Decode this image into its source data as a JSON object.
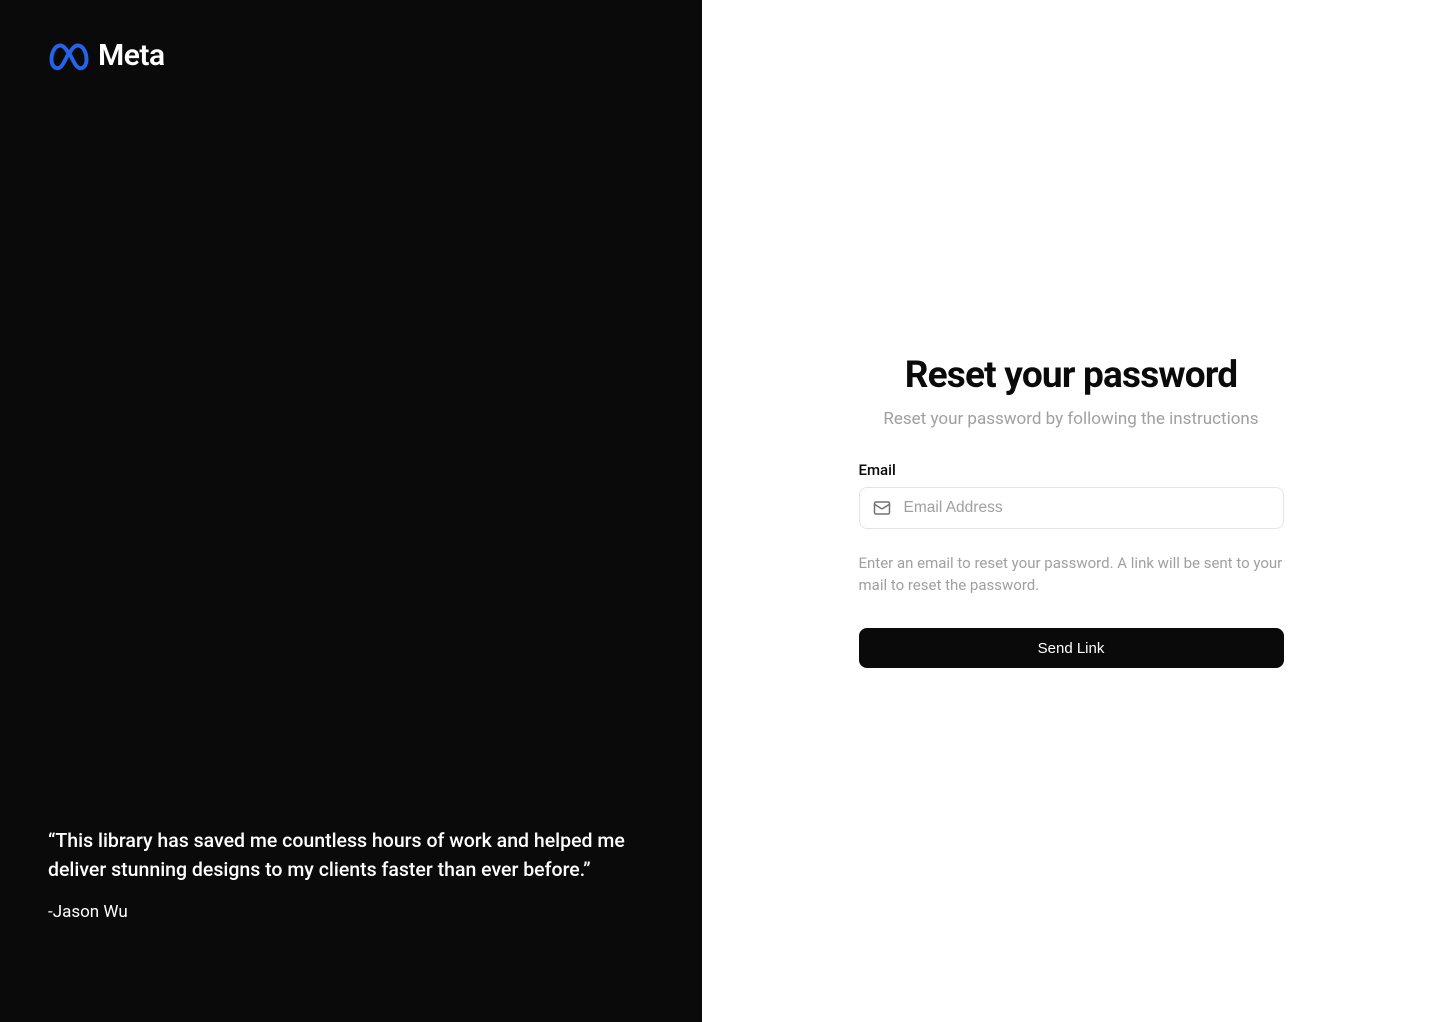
{
  "left": {
    "logo_text": "Meta",
    "quote": "“This library has saved me countless hours of work and helped me deliver stunning designs to my clients faster than ever before.”",
    "author": "-Jason Wu"
  },
  "right": {
    "title": "Reset your password",
    "subtitle": "Reset your password by following the instructions",
    "email_label": "Email",
    "email_placeholder": "Email Address",
    "email_value": "",
    "helper_text": "Enter an email to reset your password. A link will be sent to your mail to reset the password.",
    "submit_label": "Send Link"
  },
  "colors": {
    "accent": "#2563eb",
    "background_dark": "#0a0a0a",
    "text_muted": "#a0a0a0"
  }
}
